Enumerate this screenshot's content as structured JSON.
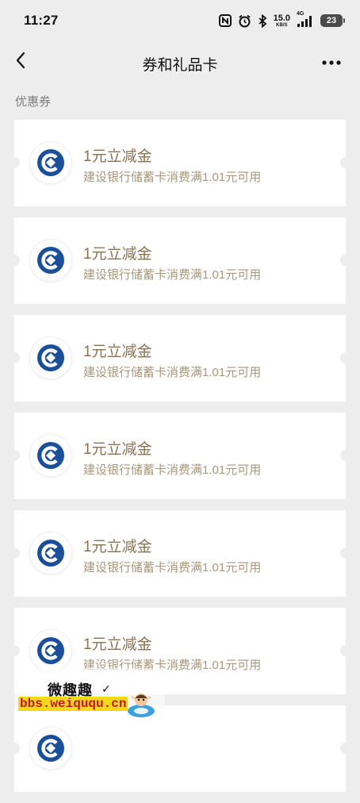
{
  "status_bar": {
    "time": "11:27",
    "net_speed_value": "15.0",
    "net_speed_unit": "KB/S",
    "network": "4G",
    "battery": "23",
    "icons": [
      "nfc-icon",
      "alarm-icon",
      "bluetooth-icon",
      "signal-icon",
      "battery-icon"
    ]
  },
  "nav": {
    "title": "券和礼品卡",
    "back_icon": "chevron-left-icon",
    "more_icon": "more-horizontal-icon"
  },
  "section": {
    "title": "优惠券"
  },
  "coupons": [
    {
      "title": "1元立减金",
      "desc": "建设银行储蓄卡消费满1.01元可用",
      "icon": "ccb-logo-icon"
    },
    {
      "title": "1元立减金",
      "desc": "建设银行储蓄卡消费满1.01元可用",
      "icon": "ccb-logo-icon"
    },
    {
      "title": "1元立减金",
      "desc": "建设银行储蓄卡消费满1.01元可用",
      "icon": "ccb-logo-icon"
    },
    {
      "title": "1元立减金",
      "desc": "建设银行储蓄卡消费满1.01元可用",
      "icon": "ccb-logo-icon"
    },
    {
      "title": "1元立减金",
      "desc": "建设银行储蓄卡消费满1.01元可用",
      "icon": "ccb-logo-icon"
    },
    {
      "title": "1元立减金",
      "desc": "建设银行储蓄卡消费满1.01元可用",
      "icon": "ccb-logo-icon"
    },
    {
      "title": "",
      "desc": "",
      "icon": "ccb-logo-icon"
    }
  ],
  "watermark": {
    "name": "微趣趣",
    "url": "bbs.weiququ.cn"
  },
  "colors": {
    "background": "#ededed",
    "card": "#ffffff",
    "coupon_title": "#8a7250",
    "coupon_desc": "#a8977a",
    "ccb_blue": "#1c4f99"
  }
}
